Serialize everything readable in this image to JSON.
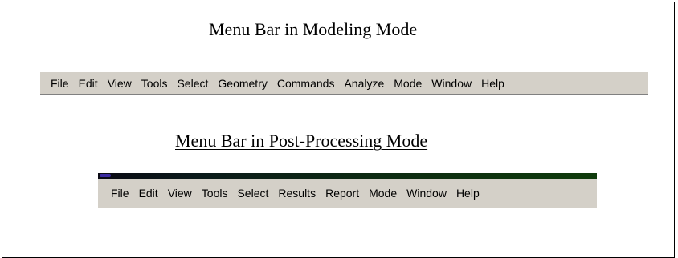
{
  "modeling": {
    "caption": "Menu Bar in Modeling Mode",
    "menu_items": [
      "File",
      "Edit",
      "View",
      "Tools",
      "Select",
      "Geometry",
      "Commands",
      "Analyze",
      "Mode",
      "Window",
      "Help"
    ]
  },
  "post_processing": {
    "caption": "Menu Bar in Post-Processing Mode",
    "menu_items": [
      "File",
      "Edit",
      "View",
      "Tools",
      "Select",
      "Results",
      "Report",
      "Mode",
      "Window",
      "Help"
    ]
  },
  "colors": {
    "menubar_bg": "#d4d0c8",
    "title_strip": "#0f3b0c"
  }
}
